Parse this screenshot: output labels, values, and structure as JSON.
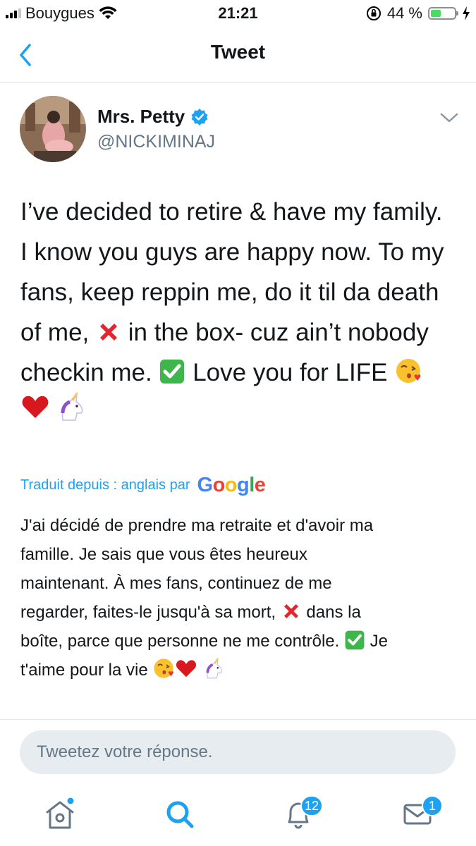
{
  "status_bar": {
    "carrier": "Bouygues",
    "time": "21:21",
    "battery": "44 %",
    "battery_level": 0.44,
    "icons": [
      "signal-icon",
      "wifi-icon",
      "orientation-lock-icon",
      "battery-icon",
      "charging-icon"
    ]
  },
  "nav": {
    "title": "Tweet",
    "back_icon": "chevron-left-icon"
  },
  "tweet": {
    "author_name": "Mrs. Petty",
    "handle": "@NICKIMINAJ",
    "verified": true,
    "text_part1": "I’ve decided to retire & have my family.\nI know you guys are happy now. To my\nfans, keep reppin me, do it til da death\nof me,",
    "text_part2": " in the box- cuz ain’t nobody\ncheckin me.",
    "text_part3": " Love you for LIFE",
    "emojis": [
      "cross-mark-emoji",
      "check-mark-emoji",
      "kiss-emoji",
      "heart-emoji",
      "unicorn-emoji"
    ]
  },
  "translation": {
    "label": "Traduit depuis : anglais par",
    "provider": "Google",
    "text_part1": "J'ai décidé de prendre ma retraite et d'avoir ma\nfamille. Je sais que vous êtes heureux\nmaintenant. À mes fans, continuez de me\nregarder, faites-le jusqu'à sa mort,",
    "text_part2": " dans la\nboîte, parce que personne ne me contrôle.",
    "text_part3": " Je\nt'aime pour la vie"
  },
  "reply": {
    "placeholder": "Tweetez votre réponse."
  },
  "tabbar": {
    "home_icon": "home-icon",
    "search_icon": "search-icon",
    "notifications_icon": "bell-icon",
    "notifications_badge": "12",
    "messages_icon": "mail-icon",
    "messages_badge": "1"
  },
  "colors": {
    "accent": "#1da1f2",
    "secondary_text": "#657786",
    "battery_green": "#4cd964"
  }
}
